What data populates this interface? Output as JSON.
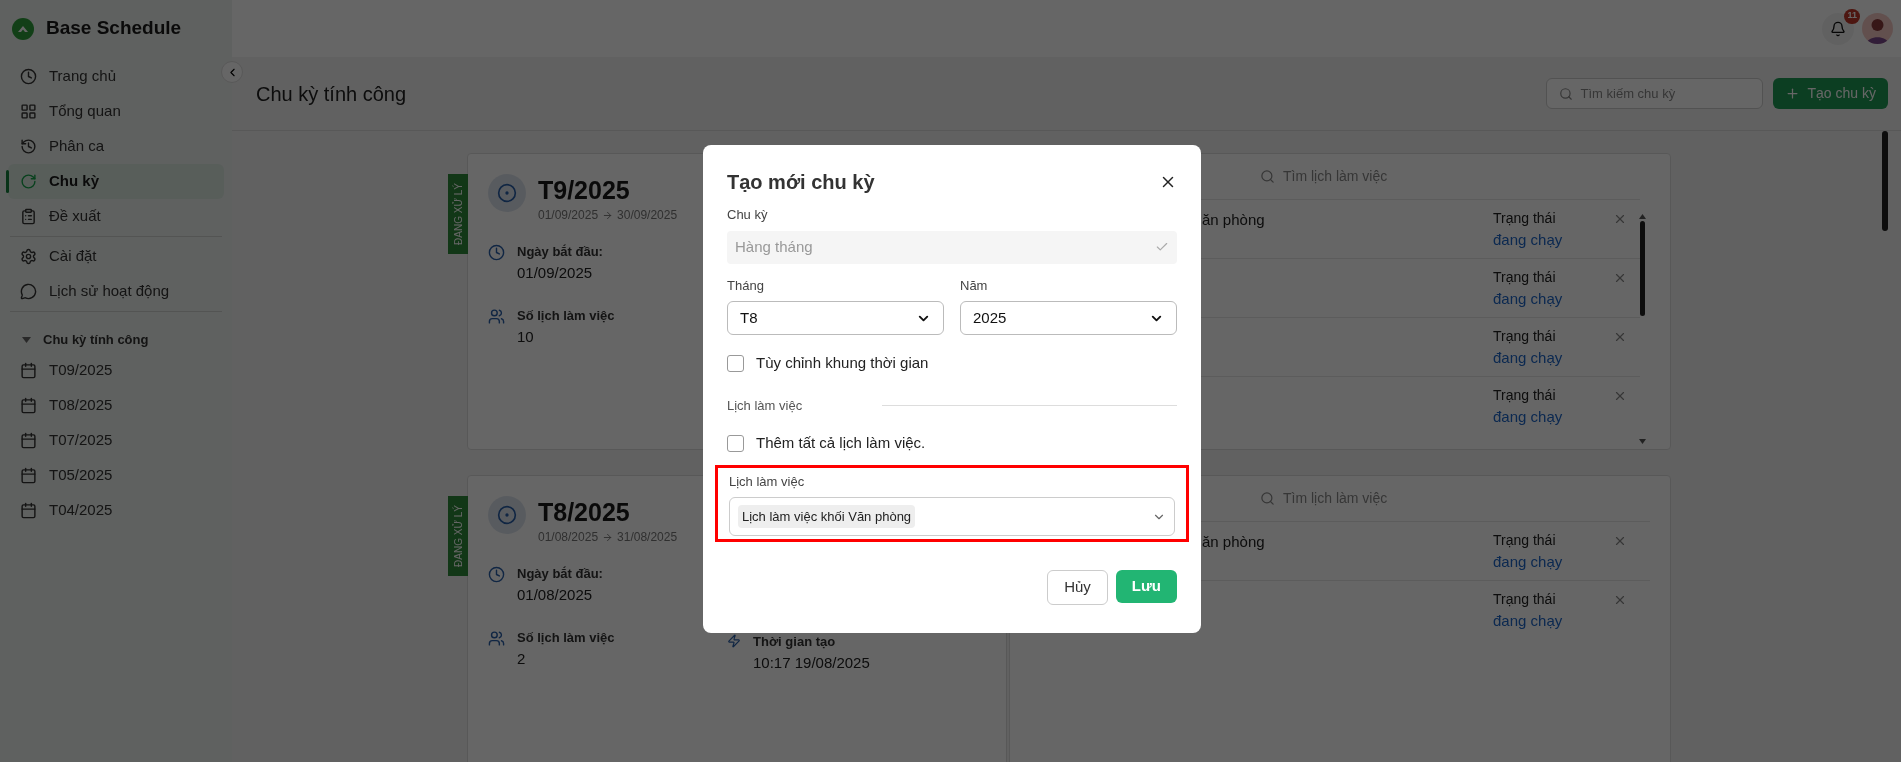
{
  "app": {
    "name": "Base Schedule"
  },
  "header": {
    "notification_count": "11"
  },
  "sidebar": {
    "groups": [
      [
        {
          "label": "Trang chủ",
          "selected": false
        },
        {
          "label": "Tổng quan",
          "selected": false
        },
        {
          "label": "Phân ca",
          "selected": false
        },
        {
          "label": "Chu kỳ",
          "selected": true
        },
        {
          "label": "Đề xuất",
          "selected": false
        }
      ],
      [
        {
          "label": "Cài đặt",
          "selected": false
        },
        {
          "label": "Lịch sử hoạt động",
          "selected": false
        }
      ]
    ],
    "section": {
      "title": "Chu kỳ tính công",
      "expanded": true,
      "items": [
        {
          "label": "T09/2025",
          "selected": false
        },
        {
          "label": "T08/2025",
          "selected": false
        },
        {
          "label": "T07/2025",
          "selected": false
        },
        {
          "label": "T05/2025",
          "selected": false
        },
        {
          "label": "T04/2025",
          "selected": false
        }
      ]
    }
  },
  "page": {
    "title": "Chu kỳ tính công",
    "search_placeholder": "Tìm kiếm chu kỳ",
    "create_button": "Tạo chu kỳ"
  },
  "cycles": [
    {
      "status": "ĐANG XỬ LÝ",
      "title": "T9/2025",
      "start": "01/09/2025",
      "end": "30/09/2025",
      "details": [
        {
          "label": "Ngày bắt đầu:",
          "value": "01/09/2025"
        },
        {
          "label": "Số lịch làm việc",
          "value": "10"
        }
      ],
      "schedule_search_placeholder": "Tìm lịch làm việc",
      "schedules": [
        {
          "name": "ăn phòng",
          "status_label": "Trạng thái",
          "status": "đang chạy"
        },
        {
          "status_label": "Trạng thái",
          "status": "đang chạy"
        },
        {
          "status_label": "Trạng thái",
          "status": "đang chạy"
        },
        {
          "status_label": "Trạng thái",
          "status": "đang chạy"
        }
      ],
      "scrollable": true
    },
    {
      "status": "ĐANG XỬ LÝ",
      "title": "T8/2025",
      "start": "01/08/2025",
      "end": "31/08/2025",
      "details": [
        {
          "label": "Ngày bắt đầu:",
          "value": "01/08/2025"
        },
        {
          "label": "Số lịch làm việc",
          "value": "2"
        }
      ],
      "created": {
        "label": "Thời gian tạo",
        "value": "10:17 19/08/2025"
      },
      "schedule_search_placeholder": "Tìm lịch làm việc",
      "schedules": [
        {
          "name": "ăn phòng",
          "status_label": "Trạng thái",
          "status": "đang chạy"
        },
        {
          "status_label": "Trạng thái",
          "status": "đang chạy"
        }
      ],
      "scrollable": false
    }
  ],
  "modal": {
    "title": "Tạo mới chu kỳ",
    "cycle": {
      "label": "Chu kỳ",
      "value": "Hàng tháng",
      "disabled": true
    },
    "month": {
      "label": "Tháng",
      "value": "T8"
    },
    "year": {
      "label": "Năm",
      "value": "2025"
    },
    "custom_range": {
      "label": "Tùy chỉnh khung thời gian",
      "checked": false
    },
    "schedules_section": "Lịch làm việc",
    "add_all": {
      "label": "Thêm tất cả lịch làm việc.",
      "checked": false
    },
    "schedule_select": {
      "label": "Lịch làm việc",
      "tags": [
        "Lịch làm việc khối Văn phòng"
      ],
      "highlighted": true
    },
    "cancel_button": "Hủy",
    "save_button": "Lưu"
  }
}
